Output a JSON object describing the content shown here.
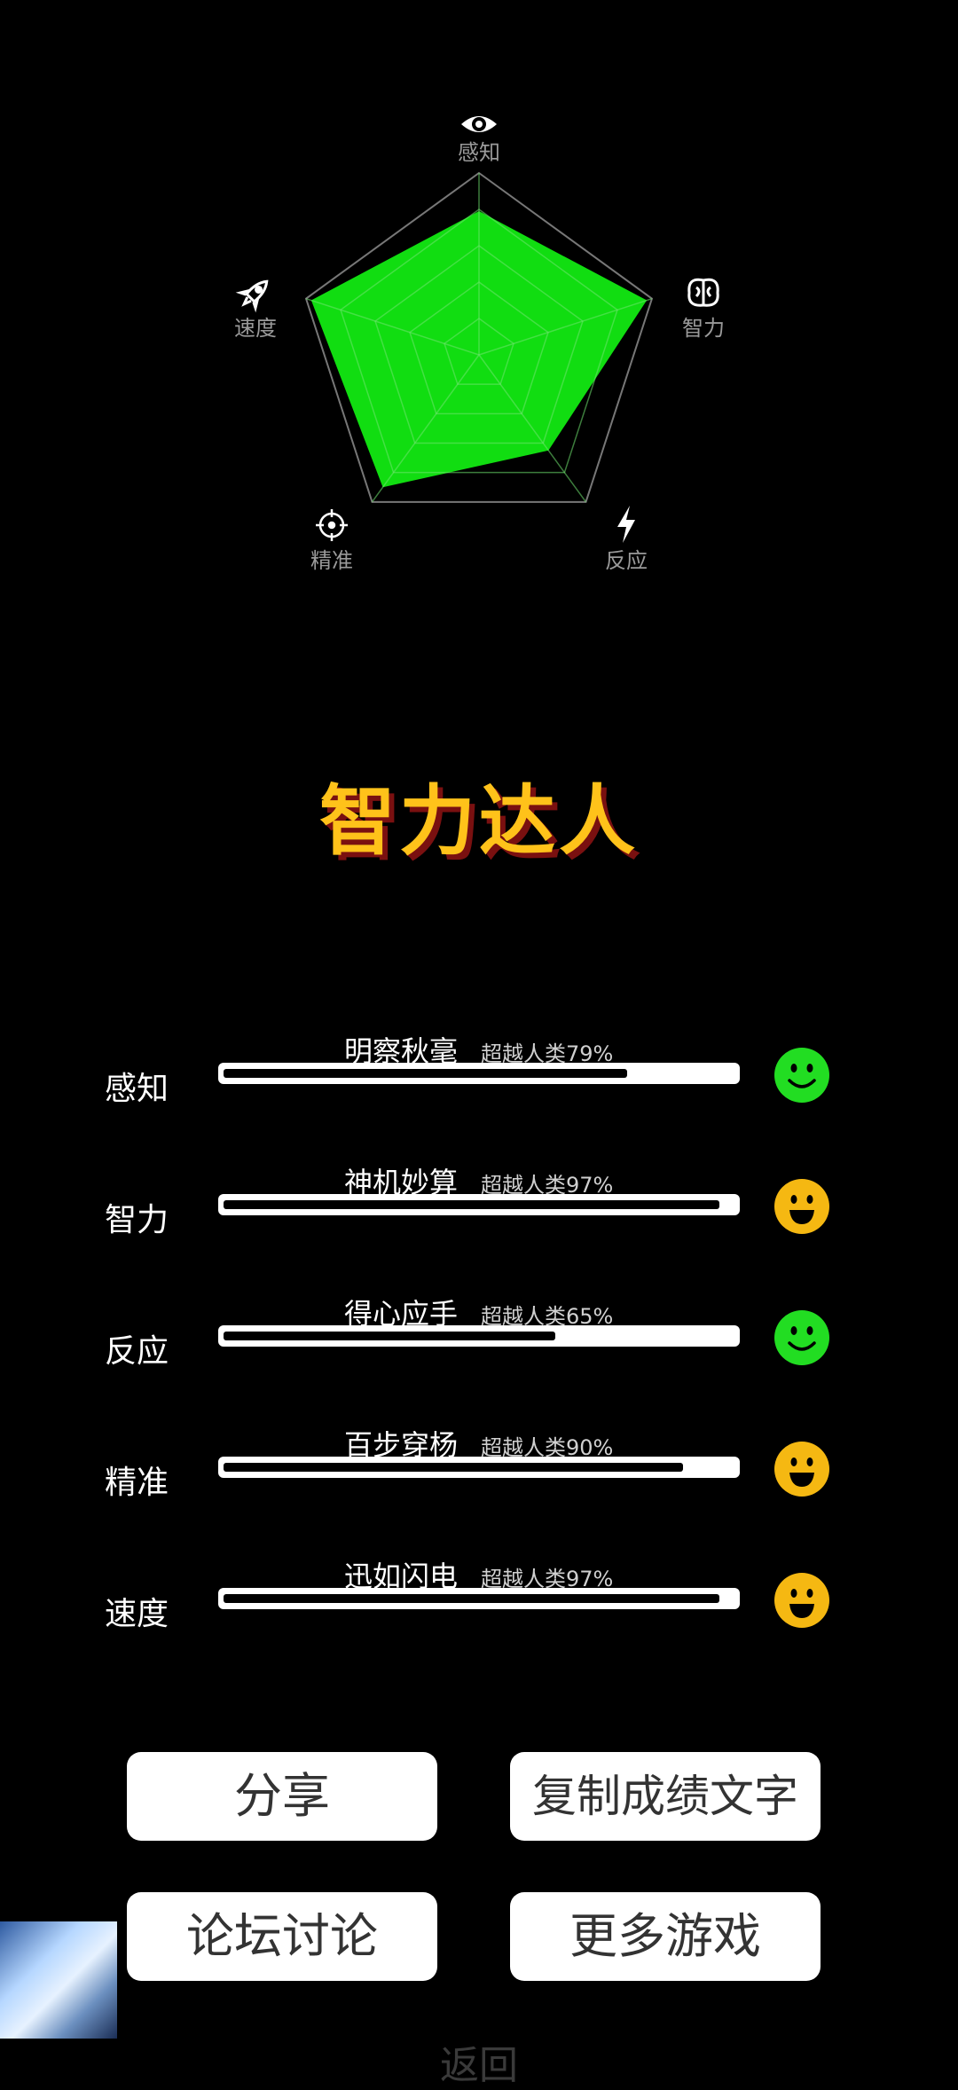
{
  "radar": {
    "axes": [
      {
        "label": "感知",
        "icon": "eye-icon",
        "value": 0.79
      },
      {
        "label": "智力",
        "icon": "brain-icon",
        "value": 0.97
      },
      {
        "label": "反应",
        "icon": "lightning-icon",
        "value": 0.65
      },
      {
        "label": "精准",
        "icon": "target-icon",
        "value": 0.9
      },
      {
        "label": "速度",
        "icon": "rocket-icon",
        "value": 0.97
      }
    ],
    "fill_color": "#11DD11",
    "grid_color": "#777777"
  },
  "rank_title": "智力达人",
  "stats": [
    {
      "label": "感知",
      "title": "明察秋毫",
      "percent_text": "超越人类79%",
      "percent": 79,
      "face": "smile",
      "face_color": "#22DD22"
    },
    {
      "label": "智力",
      "title": "神机妙算",
      "percent_text": "超越人类97%",
      "percent": 97,
      "face": "grin",
      "face_color": "#F5B812"
    },
    {
      "label": "反应",
      "title": "得心应手",
      "percent_text": "超越人类65%",
      "percent": 65,
      "face": "smile",
      "face_color": "#22DD22"
    },
    {
      "label": "精准",
      "title": "百步穿杨",
      "percent_text": "超越人类90%",
      "percent": 90,
      "face": "grin",
      "face_color": "#F5B812"
    },
    {
      "label": "速度",
      "title": "迅如闪电",
      "percent_text": "超越人类97%",
      "percent": 97,
      "face": "grin",
      "face_color": "#F5B812"
    }
  ],
  "buttons": {
    "share": "分享",
    "copy": "复制成绩文字",
    "forum": "论坛讨论",
    "more": "更多游戏"
  },
  "back_label": "返回"
}
